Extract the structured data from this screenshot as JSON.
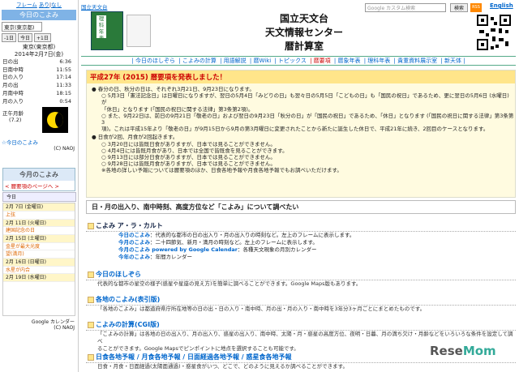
{
  "sidebar": {
    "top_links": [
      "フレーム",
      "あり",
      "なし"
    ],
    "today_title": "今日のこよみ",
    "city": "東京(東京都)",
    "nav": [
      "-1日",
      "今日",
      "+1日"
    ],
    "place": "東京(東京都)",
    "date": "2014年2月7日(金)",
    "times": [
      [
        "日の出",
        "6:36"
      ],
      [
        "日南中時",
        "11:55"
      ],
      [
        "日の入り",
        "17:14"
      ],
      [
        "月の出",
        "11:33"
      ],
      [
        "月南中時",
        "18:15"
      ],
      [
        "月の入り",
        "0:54"
      ]
    ],
    "moon_label": "正午月齢",
    "moon_age": "(7.2)",
    "link": "☆今日のこよみ",
    "naoj": "(C) NAOJ",
    "box_title": "今月のこよみ",
    "box_sub": "< 暦要項のページへ >",
    "gadget_label": "今日",
    "month_items": [
      "2月 7日 (金曜日)",
      "上弦",
      "2月 11日 (火曜日)",
      "建国記念の日",
      "2月 15日 (土曜日)",
      "金星が最大光度",
      "望(満月)",
      "2月 16日 (日曜日)",
      "水星が内合",
      "2月 19日 (水曜日)"
    ],
    "gcal": "Google カレンダー",
    "naoj2": "(C) NAOJ"
  },
  "header": {
    "home_link": "国立天文台",
    "book_text": "理科年表",
    "title_lines": [
      "国立天文台",
      "天文情報センター",
      "暦計算室"
    ],
    "search_placeholder": "Google カスタム検索",
    "search_button": "検索",
    "rss": "RSS",
    "english": "English"
  },
  "nav": [
    "| 今日のほしぞら",
    "| こよみの計算",
    "| 用語解説",
    "| 暦Wiki",
    "| トピックス",
    "| 暦要項",
    "| 暦象年表",
    "| 理科年表",
    "| 貴重資料展示室",
    "| 新天体 |"
  ],
  "nav_current": 5,
  "announce": {
    "title": "平成27年 (2015) 暦要項を発表しました！",
    "lines": [
      "● 春分の日、秋分の日は、それぞれ3月21日、9月23日になります。",
      "○ 5月3日「憲法記念日」は日曜日になりますが、翌日の5月4日「みどりの日」も翌々日の5月5日「こどもの日」も「国民の祝日」であるため、更に翌日の5月6日 (水曜日) が",
      "「休日」となります (「国民の祝日に関する法律」第3条第2項)。",
      "○ また、9月22日は、前日の9月21日「敬老の日」および翌日の9月23日「秋分の日」が「国民の祝日」であるため、「休日」となります (「国民の祝日に関する法律」第3条第3",
      "項)。これは平成15年より「敬老の日」が9月15日から9月の第3月曜日に変更されたことから新たに誕生した休日で、平成21年に続き、2回目のケースとなります。",
      "● 日食が2回、月食が2回起きます。",
      "○ 3月20日には皆既日食がありますが、日本では見ることができません。",
      "○ 4月4日には皆既月食があり、日本では全国で皆既食を見ることができます。",
      "○ 9月13日には部分日食がありますが、日本では見ることができません。",
      "○ 9月28日には皆既月食がありますが、日本では見ることができません。",
      "※各地の詳しい予報については暦要項のほか、日食各地予報や月食各地予報でもお調べいただけます。"
    ]
  },
  "section_title": "日・月の出入り、南中時刻、高度方位など「こよみ」について調べたい",
  "koyomi": {
    "h": "こよみ ア・ラ・カルト",
    "items": [
      [
        "今日のこよみ",
        "：代表的な都市の日の出入り・月の出入りの時刻など。左上のフレームに表示します。"
      ],
      [
        "今月のこよみ",
        "：二十四節気、新月・満月の時刻など。左上のフレームに表示します。"
      ],
      [
        "今月のこよみ powered by Google Calendar",
        "：各種天文現象の月別カレンダー"
      ],
      [
        "今年のこよみ",
        "：年間カレンダー"
      ]
    ]
  },
  "hoshizora": {
    "h": "今日のほしぞら",
    "body": "代表的な都市の星空の様子(惑星や星座の見え方)を簡単に調べることができます。Google Maps版もあります。"
  },
  "kakuchi": {
    "h": "各地のこよみ(表引版)",
    "body": "「各地のこよみ」は都道府県庁所在地等の日の出・日の入り・南中時、月の出・月の入り・南中時を3年分3ヶ月ごとにまとめたものです。"
  },
  "keisan": {
    "h": "こよみの計算(CGI版)",
    "body1": "「こよみの計算」は各地の日の出入り、月の出入り、惑星の出入り、南中時、太陽・月・惑星の高度方位、夜明・日暮、月の満ち欠け・月齢などをいろいろな条件を設定して調べ",
    "body2": "ることができます。Google Mapsでピンポイントに地点を選択することも可能です。"
  },
  "yoho": {
    "h": [
      "日食各地予報",
      "月食各地予報",
      "日面経過各地予報",
      "惑星食各地予報"
    ],
    "body": "日食・月食・日面経過(太陽面通過)・惑星食がいつ、どこで、どのように見えるか調べることができます。"
  },
  "watermark": {
    "a": "Rese",
    "b": "Mom"
  }
}
